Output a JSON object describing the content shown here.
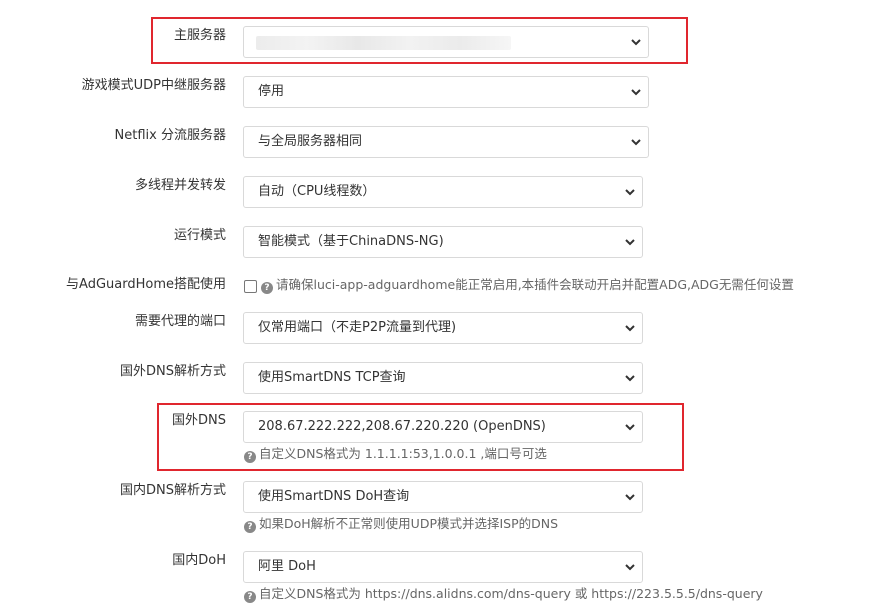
{
  "fields": {
    "main_server": {
      "label": "主服务器",
      "value": ""
    },
    "udp_relay": {
      "label": "游戏模式UDP中继服务器",
      "value": "停用"
    },
    "netflix": {
      "label": "Netflix 分流服务器",
      "value": "与全局服务器相同"
    },
    "multithread": {
      "label": "多线程并发转发",
      "value": "自动（CPU线程数）"
    },
    "run_mode": {
      "label": "运行模式",
      "value": "智能模式（基于ChinaDNS-NG)"
    },
    "adguard": {
      "label": "与AdGuardHome搭配使用",
      "hint": "请确保luci-app-adguardhome能正常启用,本插件会联动开启并配置ADG,ADG无需任何设置"
    },
    "proxy_ports": {
      "label": "需要代理的端口",
      "value": "仅常用端口（不走P2P流量到代理)"
    },
    "foreign_dns_mode": {
      "label": "国外DNS解析方式",
      "value": "使用SmartDNS TCP查询"
    },
    "foreign_dns": {
      "label": "国外DNS",
      "value": "208.67.222.222,208.67.220.220 (OpenDNS)",
      "hint": "自定义DNS格式为 1.1.1.1:53,1.0.0.1 ,端口号可选"
    },
    "domestic_dns_mode": {
      "label": "国内DNS解析方式",
      "value": "使用SmartDNS DoH查询",
      "hint": "如果DoH解析不正常则使用UDP模式并选择ISP的DNS"
    },
    "domestic_doh": {
      "label": "国内DoH",
      "value": "阿里 DoH",
      "hint": "自定义DNS格式为 https://dns.alidns.com/dns-query 或 https://223.5.5.5/dns-query"
    }
  },
  "icons": {
    "help": "question-circle-icon",
    "dropdown": "chevron-down-icon"
  },
  "colors": {
    "highlight": "#e0262e",
    "border": "#d9d9d9",
    "text": "#333333",
    "hint": "#666666"
  }
}
